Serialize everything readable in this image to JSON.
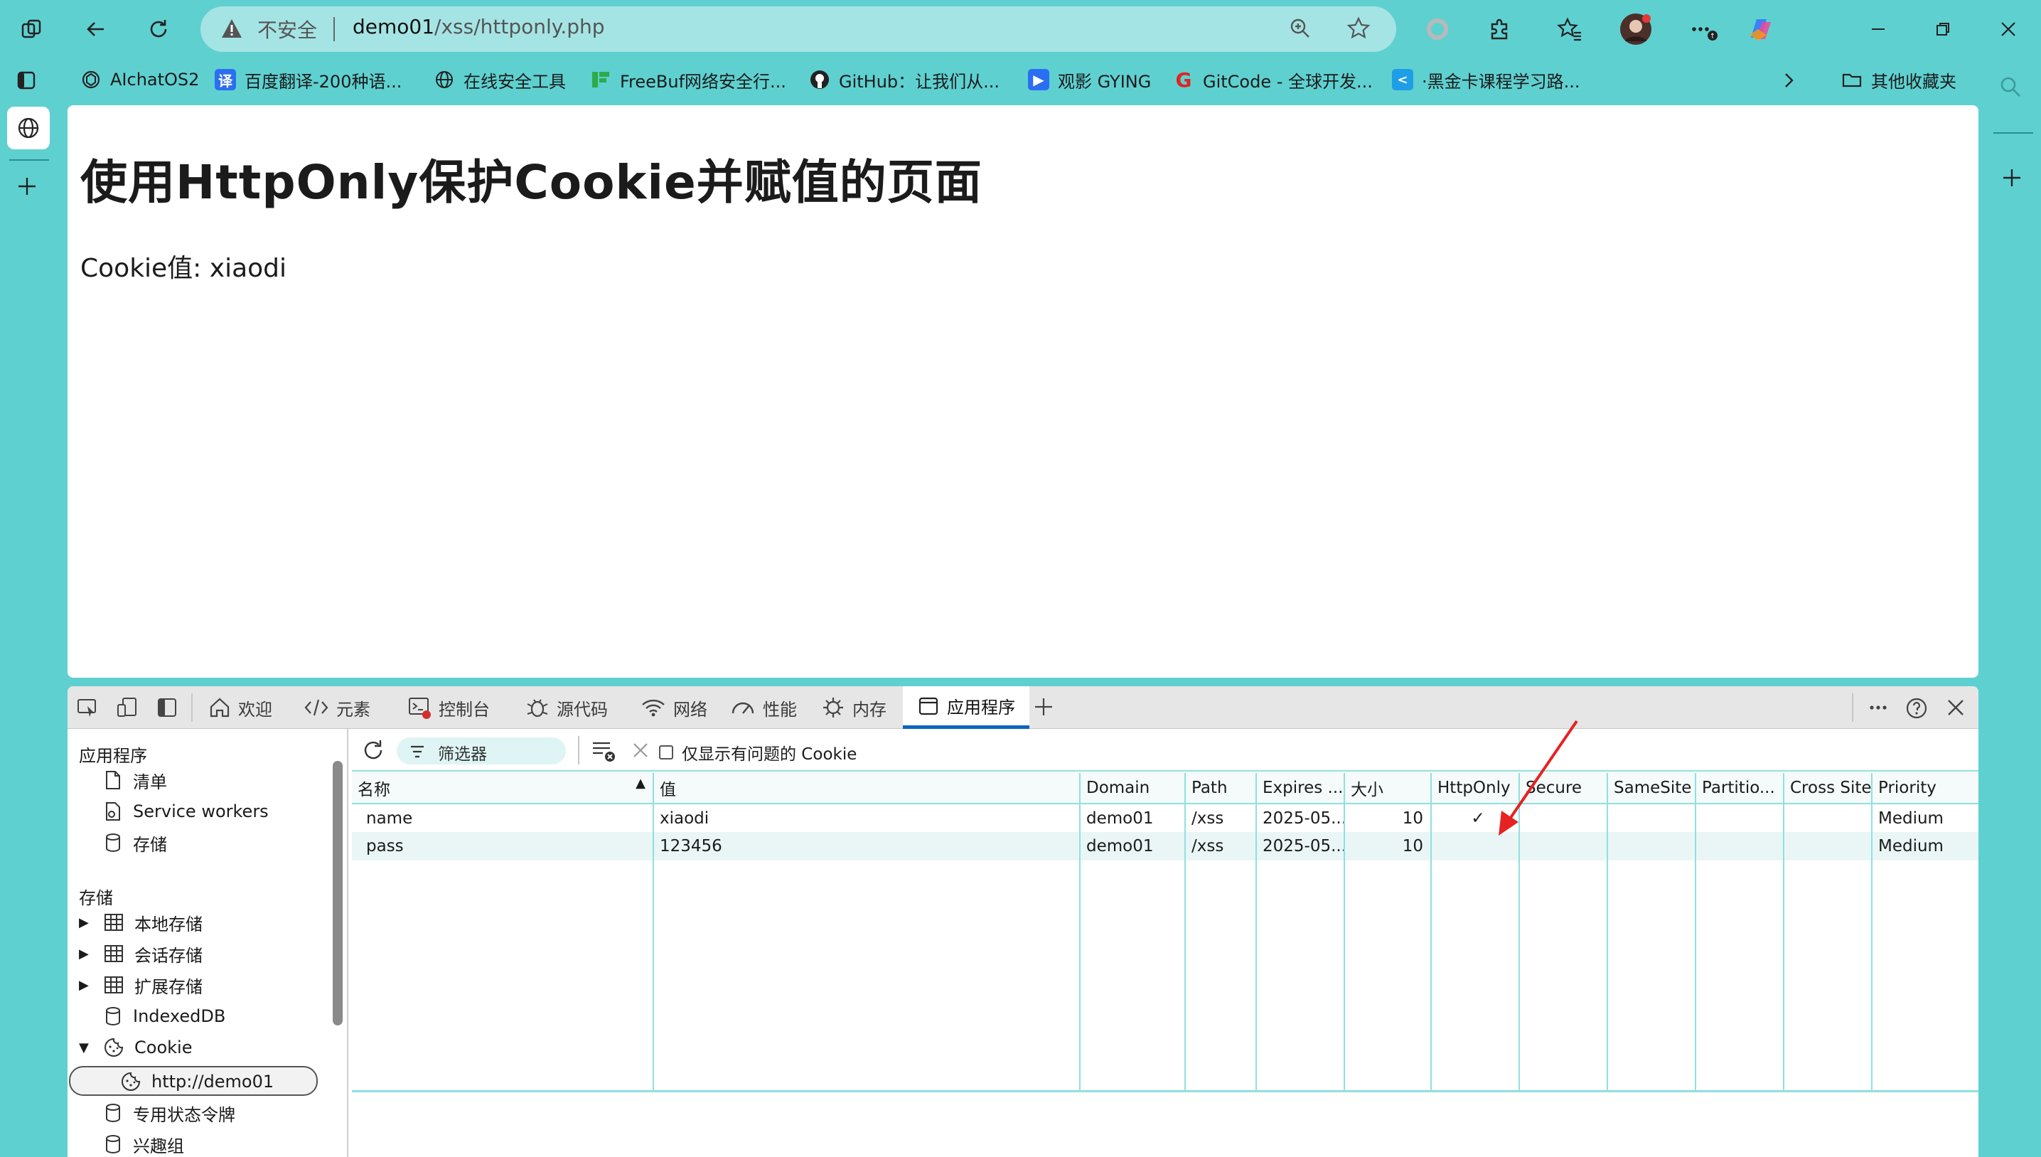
{
  "browser": {
    "security_label": "不安全",
    "url_host": "demo01",
    "url_path": "/xss/httponly.php"
  },
  "bookmarks": [
    {
      "label": "AIchatOS2",
      "icon": "openai-icon"
    },
    {
      "label": "百度翻译-200种语...",
      "icon": "translate-icon"
    },
    {
      "label": "在线安全工具",
      "icon": "globe-icon"
    },
    {
      "label": "FreeBuf网络安全行...",
      "icon": "freebuf-icon"
    },
    {
      "label": "GitHub：让我们从...",
      "icon": "github-icon"
    },
    {
      "label": "观影 GYING",
      "icon": "play-icon"
    },
    {
      "label": "GitCode - 全球开发...",
      "icon": "gitcode-icon"
    },
    {
      "label": "·黑金卡课程学习路...",
      "icon": "course-icon"
    }
  ],
  "other_bookmarks": "其他收藏夹",
  "page": {
    "heading": "使用HttpOnly保护Cookie并赋值的页面",
    "cookie_line": "Cookie值: xiaodi"
  },
  "devtools": {
    "tabs": [
      "欢迎",
      "元素",
      "控制台",
      "源代码",
      "网络",
      "性能",
      "内存",
      "应用程序"
    ],
    "active_tab": "应用程序",
    "sidebar": {
      "section_app": "应用程序",
      "app_items": [
        "清单",
        "Service workers",
        "存储"
      ],
      "section_storage": "存储",
      "storage_items": [
        "本地存储",
        "会话存储",
        "扩展存储",
        "IndexedDB",
        "Cookie"
      ],
      "cookie_origin": "http://demo01",
      "more_items": [
        "专用状态令牌",
        "兴趣组"
      ]
    },
    "toolbar": {
      "filter_placeholder": "筛选器",
      "only_issues_label": "仅显示有问题的 Cookie"
    },
    "columns": [
      "名称",
      "值",
      "Domain",
      "Path",
      "Expires ...",
      "大小",
      "HttpOnly",
      "Secure",
      "SameSite",
      "Partitio...",
      "Cross Site",
      "Priority"
    ],
    "rows": [
      [
        "name",
        "xiaodi",
        "demo01",
        "/xss",
        "2025-05...",
        "10",
        "✓",
        "",
        "",
        "",
        "",
        "Medium"
      ],
      [
        "pass",
        "123456",
        "demo01",
        "/xss",
        "2025-05...",
        "10",
        "",
        "",
        "",
        "",
        "",
        "Medium"
      ]
    ]
  },
  "colors": {
    "frame": "#5fd0d0",
    "annotation_arrow": "#e62222",
    "active_tab_underline": "#0a66c2"
  }
}
